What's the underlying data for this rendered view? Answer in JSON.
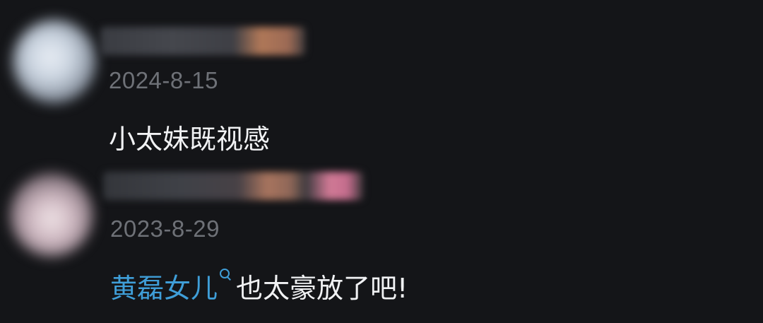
{
  "comments": [
    {
      "date": "2024-8-15",
      "text": "小太妹既视感"
    },
    {
      "date": "2023-8-29",
      "mention": "黄磊女儿",
      "text": "也太豪放了吧!"
    }
  ],
  "colors": {
    "background": "#141518",
    "date_text": "#6e7177",
    "body_text": "#f1f2f4",
    "mention_link": "#3f9ed8"
  },
  "icons": {
    "search_mark": "search-icon"
  }
}
